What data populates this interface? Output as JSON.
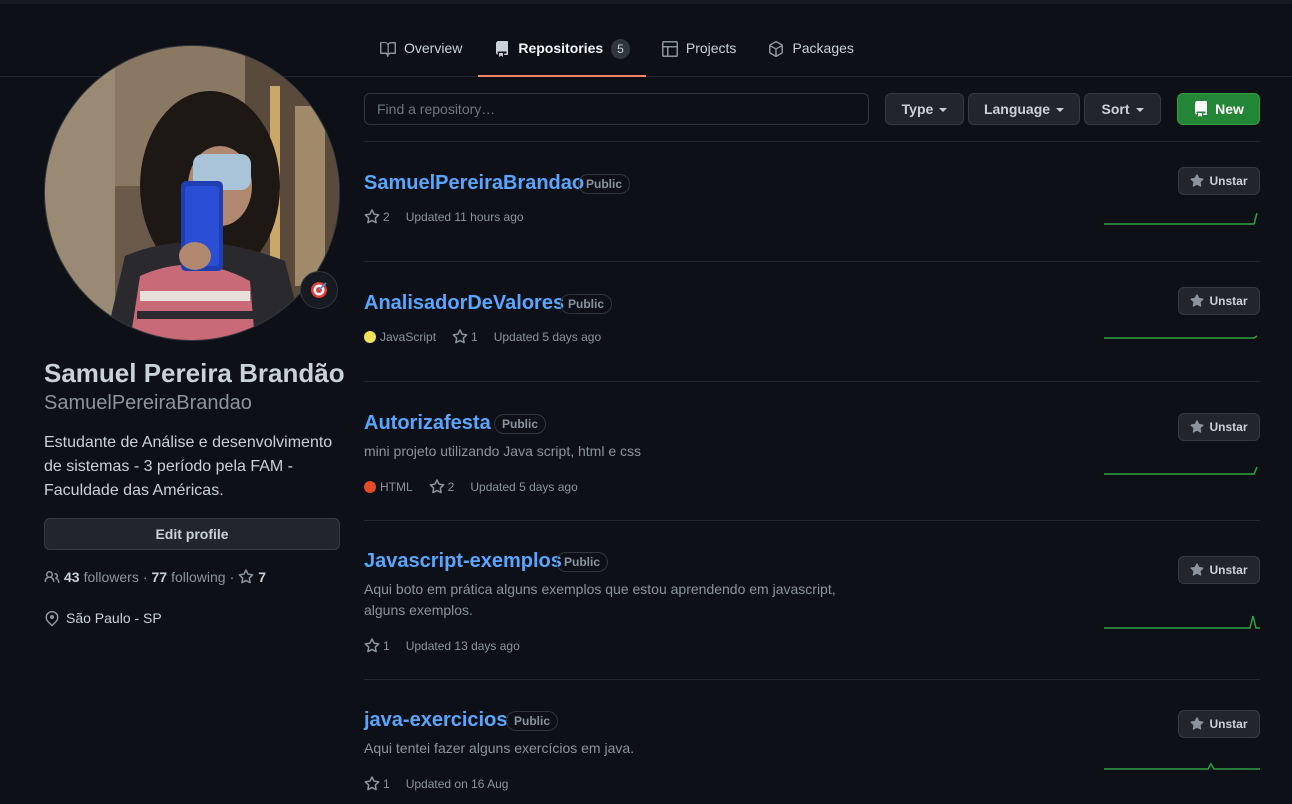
{
  "nav": {
    "tabs": [
      {
        "label": "Overview",
        "icon": "book-open-icon"
      },
      {
        "label": "Repositories",
        "icon": "repo-icon",
        "count": "5",
        "active": true
      },
      {
        "label": "Projects",
        "icon": "table-icon"
      },
      {
        "label": "Packages",
        "icon": "package-icon"
      }
    ]
  },
  "profile": {
    "full_name": "Samuel Pereira Brandão",
    "username": "SamuelPereiraBrandao",
    "bio": "Estudante de Análise e desenvolvimento de sistemas - 3 período pela FAM - Faculdade das Américas.",
    "edit_label": "Edit profile",
    "followers_count": "43",
    "followers_label": "followers",
    "following_count": "77",
    "following_label": "following",
    "separator": "·",
    "stars_count": "7",
    "location": "São Paulo - SP",
    "status_icon": "dart-target-icon"
  },
  "toolbar": {
    "search_placeholder": "Find a repository…",
    "type_label": "Type",
    "language_label": "Language",
    "sort_label": "Sort",
    "new_label": "New"
  },
  "repos": [
    {
      "name": "SamuelPereiraBrandao",
      "visibility": "Public",
      "description": "",
      "language": "",
      "stars": "2",
      "updated": "Updated 11 hours ago",
      "star_button": "Unstar"
    },
    {
      "name": "AnalisadorDeValores",
      "visibility": "Public",
      "description": "",
      "language": "JavaScript",
      "language_color": "#f1e05a",
      "stars": "1",
      "updated": "Updated 5 days ago",
      "star_button": "Unstar"
    },
    {
      "name": "Autorizafesta",
      "visibility": "Public",
      "description": "mini projeto utilizando Java script, html e css",
      "language": "HTML",
      "language_color": "#e34c26",
      "stars": "2",
      "updated": "Updated 5 days ago",
      "star_button": "Unstar"
    },
    {
      "name": "Javascript-exemplos",
      "visibility": "Public",
      "description": "Aqui boto em prática alguns exemplos que estou aprendendo em javascript, alguns exemplos.",
      "language": "",
      "stars": "1",
      "updated": "Updated 13 days ago",
      "star_button": "Unstar"
    },
    {
      "name": "java-exercicios",
      "visibility": "Public",
      "description": "Aqui tentei fazer alguns exercícios em java.",
      "language": "",
      "stars": "1",
      "updated": "Updated on 16 Aug",
      "star_button": "Unstar"
    }
  ],
  "colors": {
    "accent_link": "#58a6ff",
    "tab_underline": "#f78166",
    "primary_button": "#238636",
    "sparkline": "#2ea043"
  }
}
